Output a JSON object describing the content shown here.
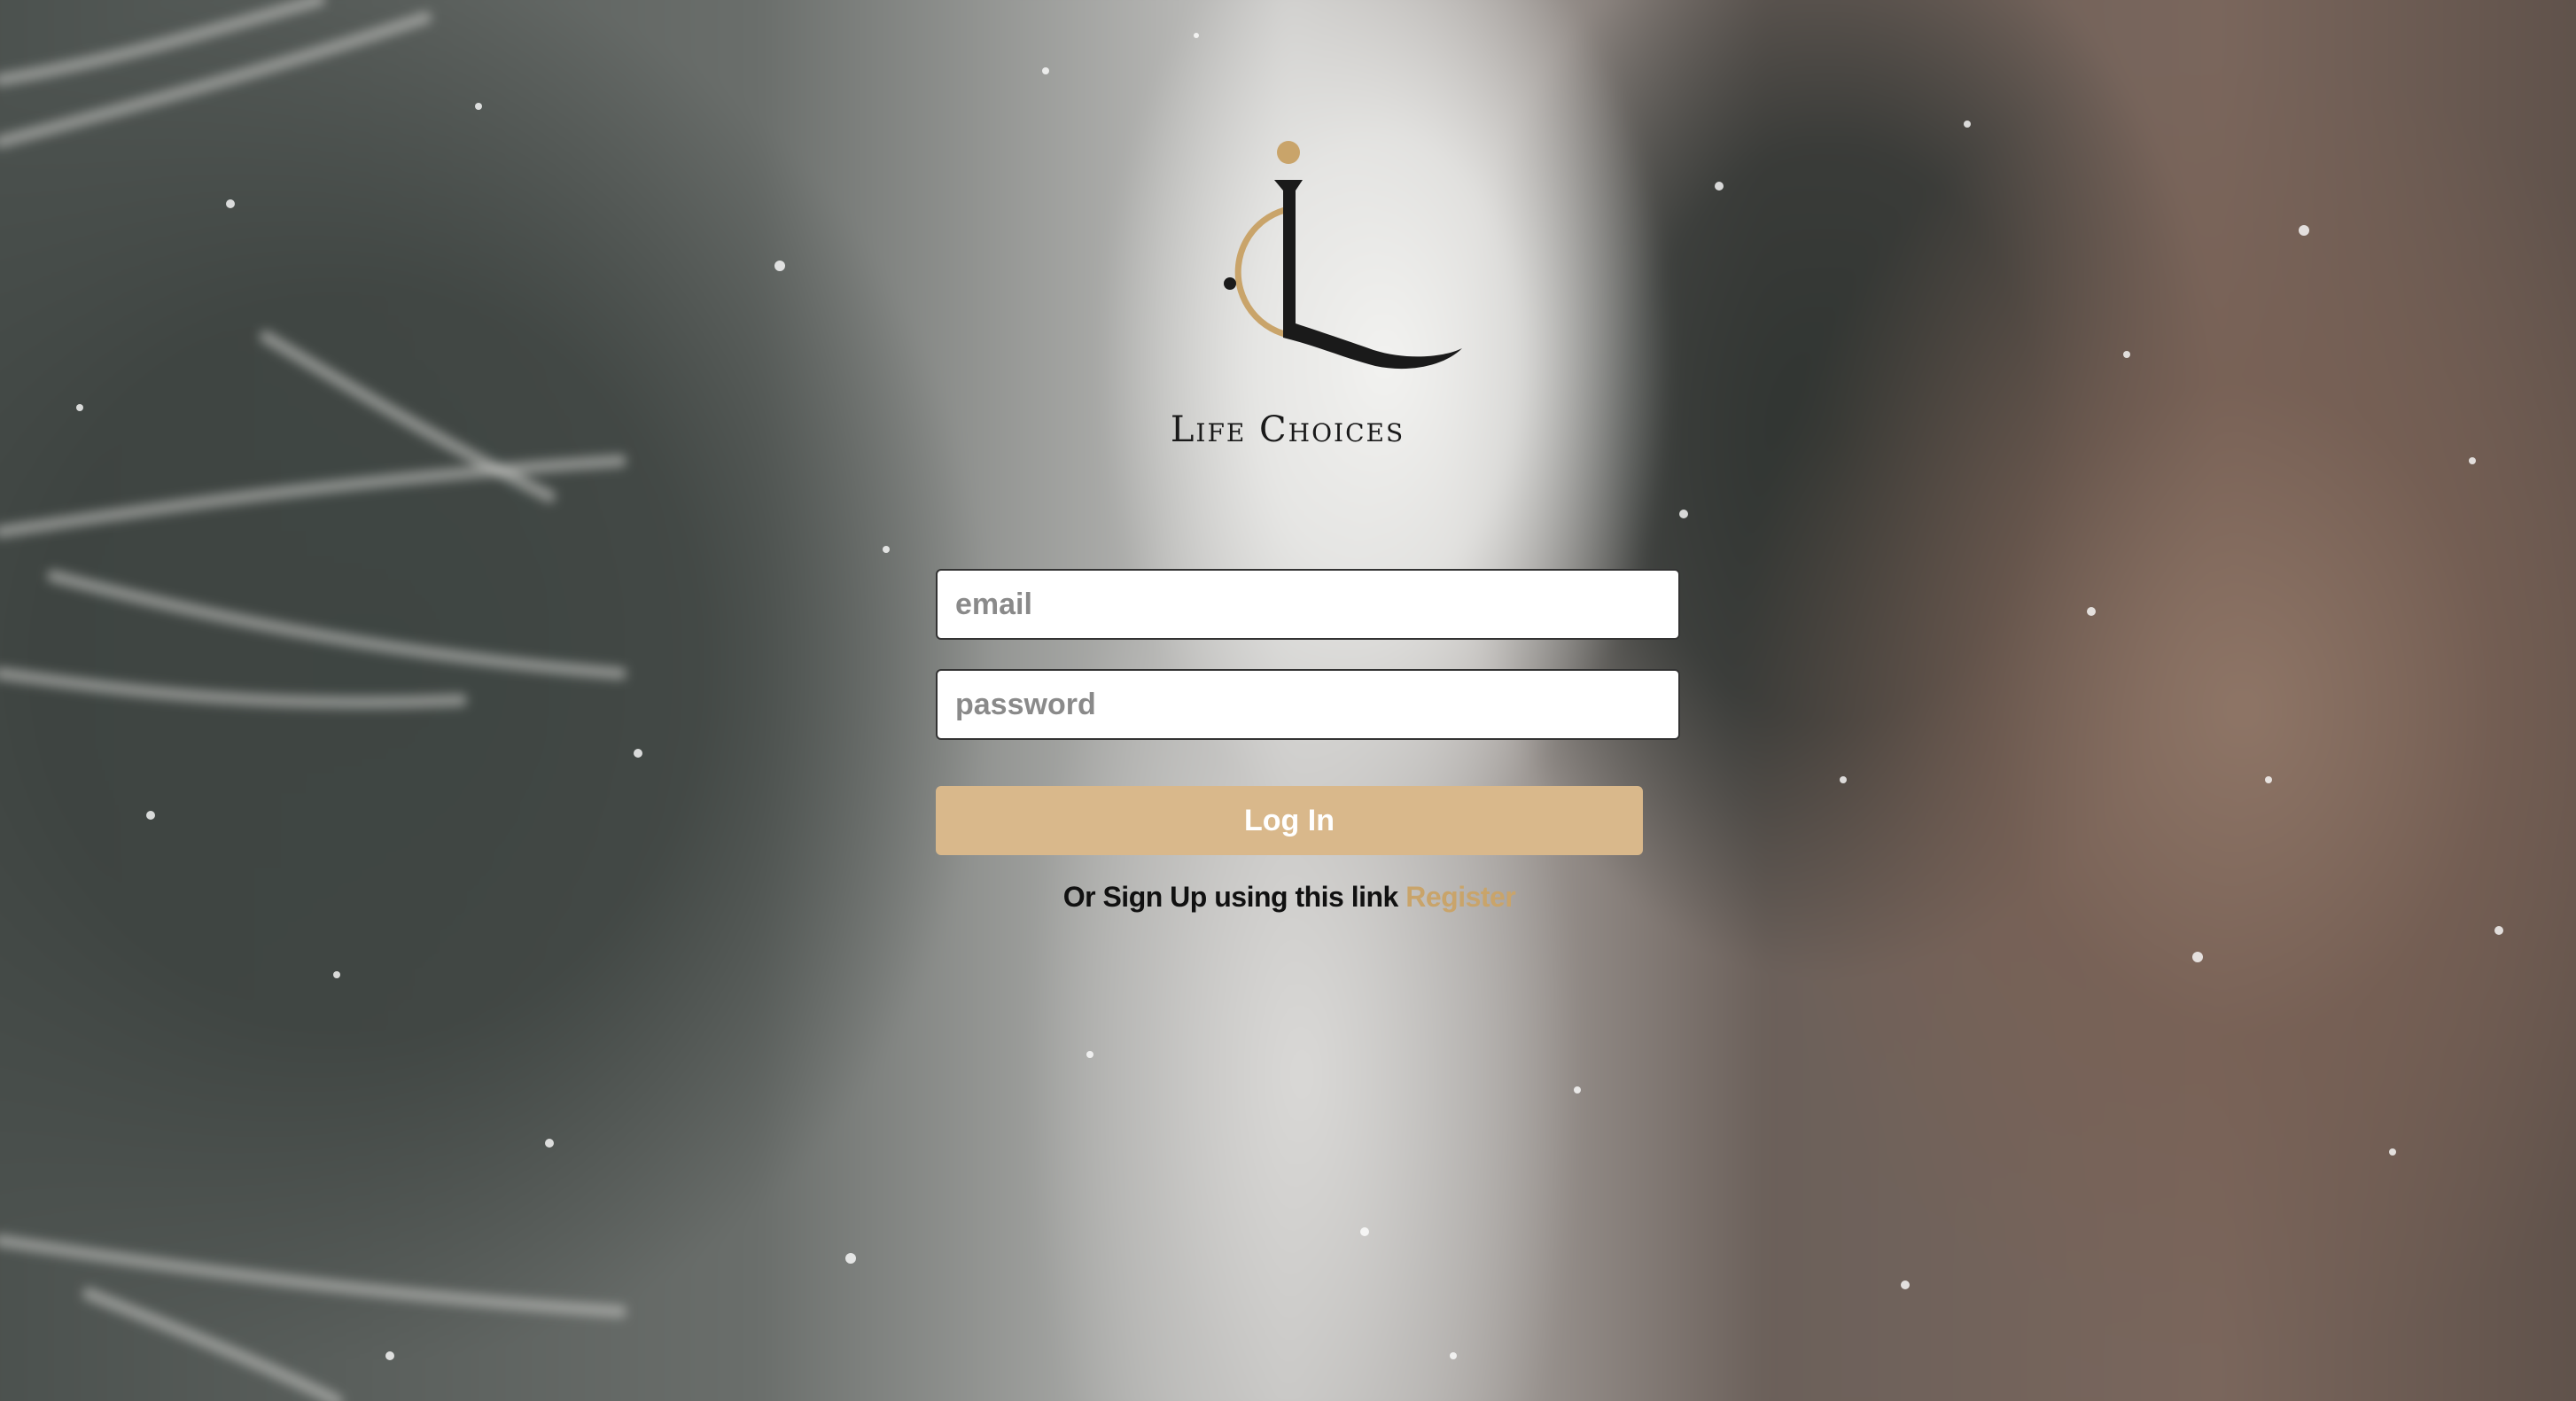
{
  "brand": {
    "name": "Life Choices",
    "logo_icon": "lc-monogram-logo",
    "colors": {
      "gold": "#c9a46a",
      "dark": "#1a1a1a"
    }
  },
  "login_form": {
    "email": {
      "placeholder": "email",
      "value": ""
    },
    "password": {
      "placeholder": "password",
      "value": ""
    },
    "login_button_label": "Log In",
    "login_button_color": "#d9b88b",
    "signup_prompt": "Or Sign Up using this link",
    "register_link_label": "Register"
  }
}
